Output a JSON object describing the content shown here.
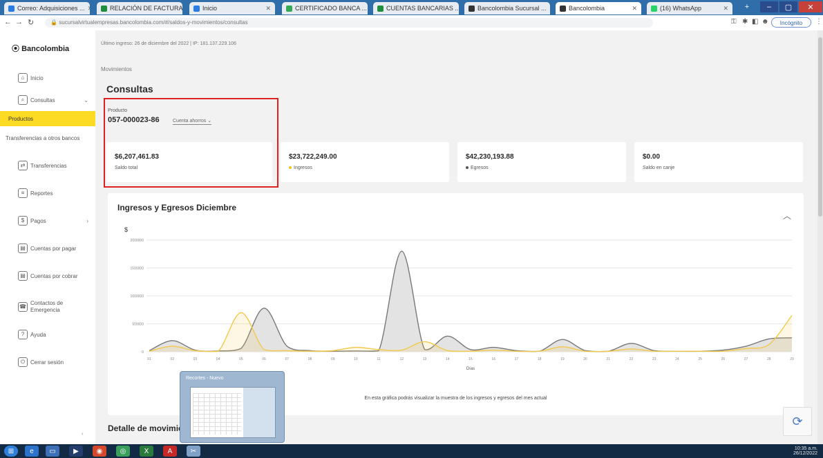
{
  "browser": {
    "tabs": [
      {
        "label": "Correo: Adquisiciones ...",
        "color": "#2a7be4"
      },
      {
        "label": "RELACIÓN DE FACTURAS ...",
        "color": "#1e8e3e"
      },
      {
        "label": "Inicio",
        "color": "#2a7be4"
      },
      {
        "label": "CERTIFICADO BANCA ...",
        "color": "#34a853"
      },
      {
        "label": "CUENTAS BANCARIAS ...",
        "color": "#1e8e3e"
      },
      {
        "label": "Bancolombia Sucursal ...",
        "color": "#333333"
      },
      {
        "label": "Bancolombia",
        "color": "#333333"
      },
      {
        "label": "(16) WhatsApp",
        "color": "#25d366"
      }
    ],
    "address": "sucursalvirtualempresas.bancolombia.com/#/saldos-y-movimientos/consultas",
    "profile_label": "Incógnito"
  },
  "sidebar": {
    "brand": "Bancolombia",
    "items": [
      {
        "label": "Inicio",
        "icon": "home-icon"
      },
      {
        "label": "Consultas",
        "icon": "search-icon",
        "chevron": "⌄"
      },
      {
        "label": "Productos",
        "active": true
      },
      {
        "label": "Transferencias a otros bancos"
      },
      {
        "label": "Transferencias",
        "icon": "transfer-icon"
      },
      {
        "label": "Reportes",
        "icon": "report-icon"
      },
      {
        "label": "Pagos",
        "icon": "payment-icon",
        "chevron": "›"
      },
      {
        "label": "Cuentas por pagar",
        "icon": "bill-icon"
      },
      {
        "label": "Cuentas por cobrar",
        "icon": "invoice-icon"
      },
      {
        "label": "Contactos de Emergencia",
        "icon": "contacts-icon"
      },
      {
        "label": "Ayuda",
        "icon": "help-icon"
      },
      {
        "label": "Cerrar sesión",
        "icon": "logout-icon"
      }
    ]
  },
  "main": {
    "last_access": "Último ingreso: 26 de diciembre del 2022 | IP: 181.137.229.106",
    "breadcrumb": "Movimientos",
    "title": "Consultas",
    "product_label": "Producto",
    "product_number": "057-000023-86",
    "product_type": "Cuenta ahorros",
    "cards": [
      {
        "amount": "$6,207,461.83",
        "label": "Saldo total"
      },
      {
        "amount": "$23,722,249.00",
        "label": "Ingresos",
        "dot_color": "#f5c518"
      },
      {
        "amount": "$42,230,193.88",
        "label": "Egresos",
        "dot_color": "#555555"
      },
      {
        "amount": "$0.00",
        "label": "Saldo en canje"
      }
    ],
    "chart_title": "Ingresos y Egresos Diciembre",
    "chart_caption": "En esta gráfica podrás visualizar la muestra de los ingresos y egresos del mes actual",
    "details_title": "Detalle de movimientos"
  },
  "chart_data": {
    "type": "area",
    "title": "Ingresos y Egresos Diciembre",
    "xlabel": "Días",
    "ylabel": "$",
    "x": [
      "01",
      "02",
      "03",
      "04",
      "05",
      "06",
      "07",
      "08",
      "09",
      "10",
      "11",
      "12",
      "13",
      "14",
      "15",
      "16",
      "17",
      "18",
      "19",
      "20",
      "21",
      "22",
      "23",
      "24",
      "25",
      "26",
      "27",
      "28",
      "29"
    ],
    "y_ticks": [
      "0",
      "500000",
      "1000000",
      "1500000",
      "2000000"
    ],
    "ylim": [
      0,
      2000000
    ],
    "series": [
      {
        "name": "Egresos",
        "color": "#777777",
        "fill": "#e3e3e3",
        "values": [
          20000,
          200000,
          30000,
          15000,
          60000,
          780000,
          100000,
          20000,
          10000,
          15000,
          20000,
          1800000,
          40000,
          280000,
          40000,
          80000,
          20000,
          10000,
          220000,
          20000,
          10000,
          150000,
          20000,
          10000,
          10000,
          30000,
          100000,
          230000,
          250000
        ]
      },
      {
        "name": "Ingresos",
        "color": "#f2c94c",
        "fill": "rgba(242,201,76,0.15)",
        "values": [
          10000,
          100000,
          20000,
          10000,
          700000,
          40000,
          20000,
          10000,
          20000,
          80000,
          40000,
          30000,
          180000,
          20000,
          10000,
          30000,
          10000,
          10000,
          90000,
          10000,
          10000,
          50000,
          10000,
          10000,
          10000,
          10000,
          60000,
          130000,
          650000
        ]
      }
    ],
    "grid": true
  },
  "popup": {
    "title": "Recortes - Nuevo"
  },
  "taskbar": {
    "time": "10:35 a.m.",
    "date": "26/12/2022"
  }
}
